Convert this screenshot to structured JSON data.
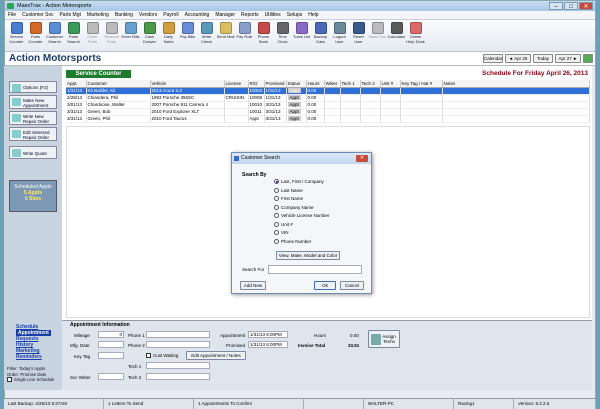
{
  "window": {
    "title": "MaxxTrax - Action Motorsports",
    "min": "–",
    "max": "□",
    "close": "✕"
  },
  "menu": [
    "File",
    "Customer Svc",
    "Parts Mgt",
    "Marketing",
    "Banking",
    "Vendors",
    "Payroll",
    "Accounting",
    "Manager",
    "Reports",
    "Utilities",
    "Setups",
    "Help"
  ],
  "toolbar": [
    {
      "label": "Service Counter",
      "color": "#4a7fd0"
    },
    {
      "label": "Parts Counter",
      "color": "#d46a2a"
    },
    {
      "label": "Customer Search",
      "color": "#5a8fd8"
    },
    {
      "label": "Parts Search",
      "color": "#3a9a5a"
    },
    {
      "label": "Order Parts",
      "color": "#bbb",
      "disabled": true
    },
    {
      "label": "Restock Parts",
      "color": "#bbb",
      "disabled": true
    },
    {
      "label": "Enter Bills",
      "color": "#6aa0d0"
    },
    {
      "label": "Cash Drawer",
      "color": "#4a9a4a"
    },
    {
      "label": "Daily Sales",
      "color": "#d0a040"
    },
    {
      "label": "Pay Bills",
      "color": "#6a8ad8"
    },
    {
      "label": "Write Check",
      "color": "#5a9ab8"
    },
    {
      "label": "Send Mail",
      "color": "#d8c060"
    },
    {
      "label": "Pay Rollr",
      "color": "#8aa0c8"
    },
    {
      "label": "Phone Book",
      "color": "#c84a4a"
    },
    {
      "label": "Time Clock",
      "color": "#666"
    },
    {
      "label": "Track List",
      "color": "#8a6ac8"
    },
    {
      "label": "Backup Data",
      "color": "#4a6ab8"
    },
    {
      "label": "Logout User",
      "color": "#6a8a9a"
    },
    {
      "label": "Reset User",
      "color": "#3a5a8a"
    },
    {
      "label": "Mass Doc",
      "color": "#bbb",
      "disabled": true
    },
    {
      "label": "Calculator",
      "color": "#5a5a5a"
    },
    {
      "label": "Online Help Desk",
      "color": "#d86a6a"
    }
  ],
  "header": {
    "company": "Action Motorsports",
    "calendar_label": "Calendar",
    "prev_day": "◄ Apr 25",
    "today_label": "Today",
    "next_day": "Apr 27 ►",
    "schedule_title": "Schedule For Friday  April 26, 2013"
  },
  "left_panel": {
    "buttons": [
      "Options (F2)",
      "Make New Appointment",
      "Write New Repair Order",
      "Edit Selected Repair Order",
      "Write Quote"
    ],
    "scheduled_title": "Scheduled Appts",
    "appts_count": "5 Appts",
    "sites_count": "0 Sites",
    "links": [
      "Schedule",
      "Appointment",
      "Requests",
      "History",
      "Marketing",
      "Reminders"
    ],
    "filter_text_1": "Filter: Today's Appts",
    "filter_text_2": "Order: Promise Date",
    "single_line_label": "Single Line Schedule"
  },
  "service_counter_label": "Service Counter",
  "grid": {
    "columns": [
      "Appt.",
      "Customer",
      "Vehicle",
      "License",
      "R/O",
      "Promised",
      "Status",
      "Hours",
      "Writer",
      "Tech 1",
      "Tech 2",
      "Unit #",
      "Key Tag / Hat #",
      "Notes"
    ],
    "rows": [
      [
        "1/31/13",
        "Kit Builder, Kit",
        "2013 Acura ILX",
        "",
        "10003",
        "1/31/13",
        "Appt",
        "0.00",
        "",
        "",
        "",
        "",
        "",
        ""
      ],
      [
        "2/28/13",
        "Chiandera, Phil",
        "1993 Porsche 356SC",
        "CRUISIN",
        "10008",
        "1/31/13",
        "Appt",
        "0.00",
        "",
        "",
        "",
        "",
        "",
        ""
      ],
      [
        "3/01/13",
        "Chardoose, Walter",
        "2007 Porsche 911 Carrera 4",
        "",
        "10010",
        "3/31/13",
        "Appt",
        "0.00",
        "",
        "",
        "",
        "",
        "",
        ""
      ],
      [
        "3/31/13",
        "Green, Bob",
        "2010 Ford Explorer XLT",
        "",
        "10011",
        "3/31/13",
        "Appt",
        "0.00",
        "",
        "",
        "",
        "",
        "",
        ""
      ],
      [
        "3/31/13",
        "Green, Phil",
        "2010 Ford Taurus",
        "",
        "Appt",
        "3/31/13",
        "Appt",
        "0.00",
        "",
        "",
        "",
        "",
        "",
        ""
      ]
    ]
  },
  "appointment_info": {
    "heading": "Appointment Information",
    "mileage_label": "Mileage",
    "mileage_value": "0",
    "mfg_date_label": "Mfg. Date",
    "key_tag_label": "Key Tag",
    "svc_writer_label": "Svc Writer",
    "phone1_label": "Phone 1",
    "phone2_label": "Phone 2",
    "tech1_label": "Tech 1",
    "tech2_label": "Tech 2",
    "cust_waiting_label": "Cust Waiting",
    "edit_button": "Edit Appointment / Notes",
    "appointment_label": "Appointment",
    "appointment_value": "1/31/13  6:00PM",
    "promised_label": "Promised",
    "promised_value": "1/31/13  6:00PM",
    "hours_label": "Hours",
    "hours_value": "0.00",
    "invoice_total_label": "Invoice Total",
    "invoice_total_value": "33.91",
    "assign_techs": "Assign Techs"
  },
  "status_bar": [
    "Last Backup: 4/26/13  8:27AM",
    "1 Letters To Send",
    "1 Appointments To Confirm",
    "",
    "WALTER-PC",
    "Racing1",
    "Version: 8.2.2.6"
  ],
  "dialog": {
    "title": "Customer Search",
    "close": "✕",
    "search_by": "Search By",
    "options": [
      "Last, First / Company",
      "Last Name",
      "First Name",
      "Company Name",
      "Vehicle License Number",
      "Unit #",
      "VIN",
      "Phone Number"
    ],
    "selected_index": 0,
    "view_button": "View, Make, Model and Color",
    "search_for_label": "Search For",
    "search_for_value": "",
    "add_new": "Add New",
    "ok": "Ok",
    "cancel": "Cancel"
  }
}
